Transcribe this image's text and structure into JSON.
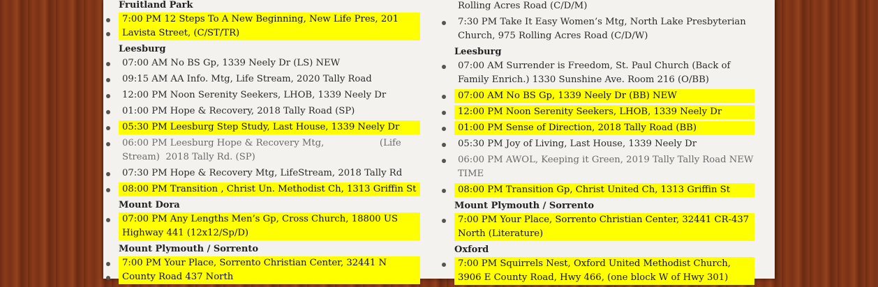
{
  "left": {
    "sections": [
      {
        "town": "Fruitland Park",
        "items": [
          {
            "text": "7:00 PM 12 Steps To A New Beginning, New Life Pres, 201 Lavista Street, (C/ST/TR)",
            "highlight": true,
            "lines": 2
          }
        ]
      },
      {
        "town": "Leesburg",
        "items": [
          {
            "text": "07:00 AM No BS Gp, 1339 Neely Dr (LS) NEW",
            "highlight": false
          },
          {
            "text": "09:15 AM AA Info. Mtg, Life Stream, 2020 Tally Road",
            "highlight": false
          },
          {
            "text": "12:00 PM Noon Serenity Seekers, LHOB, 1339 Neely Dr",
            "highlight": false
          },
          {
            "text": "01:00 PM Hope & Recovery, 2018 Tally Road (SP)",
            "highlight": false
          },
          {
            "text": "05:30 PM Leesburg Step Study, Last House, 1339 Neely Dr",
            "highlight": true
          },
          {
            "text": "06:00 PM Leesburg Hope & Recovery Mtg,                   (Life Stream)  2018 Tally Rd. (SP)",
            "highlight": false,
            "gray": true
          },
          {
            "text": "07:30 PM Hope & Recovery Mtg, LifeStream, 2018 Tally Rd",
            "highlight": false
          },
          {
            "text": "08:00 PM Transition , Christ Un. Methodist Ch, 1313 Griffin St",
            "highlight": true
          }
        ]
      },
      {
        "town": "Mount Dora",
        "items": [
          {
            "text": "07:00 PM Any Lengths Men’s Gp, Cross Church, 18800 US Highway 441 (12x12/Sp/D)",
            "highlight": true,
            "lines": 2
          }
        ]
      },
      {
        "town": "Mount Plymouth / Sorrento",
        "items": [
          {
            "text": "7:00 PM  Your Place, Sorrento Christian Center, 32441 N County Road 437 North",
            "highlight": true,
            "lines": 2
          }
        ]
      }
    ]
  },
  "right": {
    "top_items": [
      {
        "text": "Rolling Acres Road (C/D/M)",
        "highlight": false,
        "continuation": true
      },
      {
        "text": "7:30 PM Take It Easy Women’s Mtg, North Lake Presbyterian Church, 975 Rolling Acres Road (C/D/W)",
        "highlight": false
      }
    ],
    "sections": [
      {
        "town": "Leesburg",
        "items": [
          {
            "text": "07:00 AM Surrender is Freedom, St. Paul Church (Back of Family Enrich.) 1330 Sunshine Ave. Room 216 (O/BB)",
            "highlight": false
          },
          {
            "text": "07:00 AM No BS Gp, 1339 Neely Dr (BB) NEW",
            "highlight": true
          },
          {
            "text": "12:00 PM Noon Serenity Seekers, LHOB, 1339 Neely Dr",
            "highlight": true
          },
          {
            "text": "01:00 PM Sense of Direction, 2018 Tally Road (BB)",
            "highlight": true
          },
          {
            "text": "05:30 PM Joy of Living, Last House, 1339 Neely Dr",
            "highlight": false
          },
          {
            "text": "06:00 PM AWOL, Keeping it Green, 2019 Tally  Tally Road NEW TIME",
            "highlight": false,
            "gray": true
          },
          {
            "text": "08:00 PM Transition Gp, Christ United  Ch, 1313 Griffin St",
            "highlight": true
          }
        ]
      },
      {
        "town": "Mount Plymouth / Sorrento",
        "items": [
          {
            "text": "7:00 PM Your Place, Sorrento Christian Center, 32441 CR-437 North (Literature)",
            "highlight": true,
            "lines": 2
          }
        ]
      },
      {
        "town": "Oxford",
        "items": [
          {
            "text": "7:00 PM Squirrels Nest, Oxford United Methodist Church, 3906 E County Road, Hwy 466, (one block W of Hwy 301)",
            "highlight": true,
            "lines": 2
          }
        ]
      }
    ]
  }
}
